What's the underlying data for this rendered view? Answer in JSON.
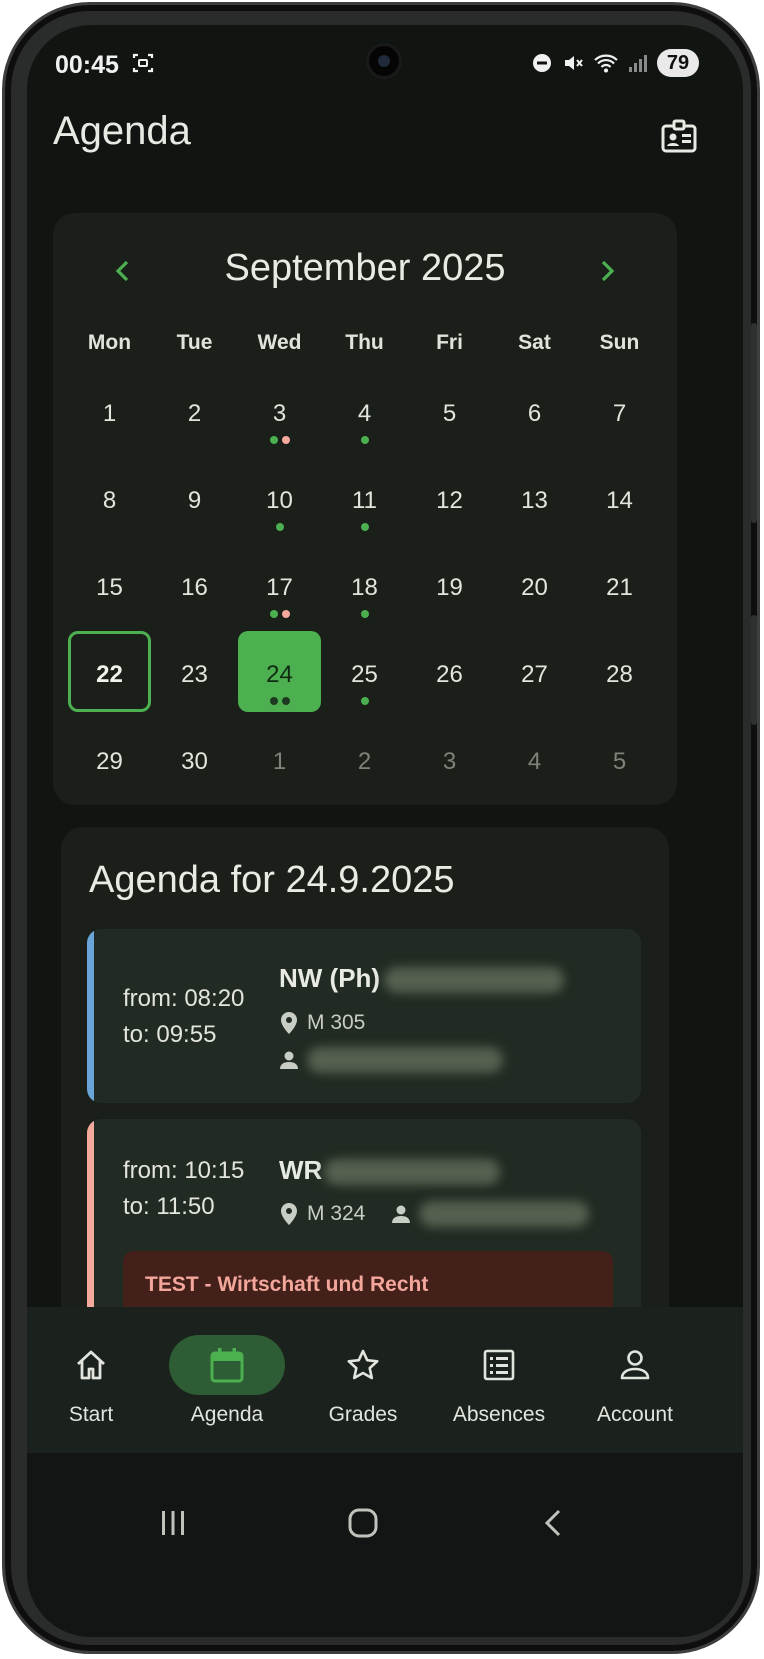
{
  "status_bar": {
    "time": "00:45",
    "battery": "79"
  },
  "header": {
    "title": "Agenda",
    "id_icon": "id-card-icon"
  },
  "calendar": {
    "month_label": "September 2025",
    "weekdays": [
      "Mon",
      "Tue",
      "Wed",
      "Thu",
      "Fri",
      "Sat",
      "Sun"
    ],
    "days": [
      {
        "label": "1"
      },
      {
        "label": "2"
      },
      {
        "label": "3",
        "dots": [
          "#4caf50",
          "#f4a99d"
        ]
      },
      {
        "label": "4",
        "dots": [
          "#4caf50"
        ]
      },
      {
        "label": "5"
      },
      {
        "label": "6"
      },
      {
        "label": "7"
      },
      {
        "label": "8"
      },
      {
        "label": "9"
      },
      {
        "label": "10",
        "dots": [
          "#4caf50"
        ]
      },
      {
        "label": "11",
        "dots": [
          "#4caf50"
        ]
      },
      {
        "label": "12"
      },
      {
        "label": "13"
      },
      {
        "label": "14"
      },
      {
        "label": "15"
      },
      {
        "label": "16"
      },
      {
        "label": "17",
        "dots": [
          "#4caf50",
          "#f4a99d"
        ]
      },
      {
        "label": "18",
        "dots": [
          "#4caf50"
        ]
      },
      {
        "label": "19"
      },
      {
        "label": "20"
      },
      {
        "label": "21"
      },
      {
        "label": "22",
        "today": true
      },
      {
        "label": "23"
      },
      {
        "label": "24",
        "selected": true,
        "dots": [
          "#1d3a20",
          "#1d3a20"
        ]
      },
      {
        "label": "25",
        "dots": [
          "#4caf50"
        ]
      },
      {
        "label": "26"
      },
      {
        "label": "27"
      },
      {
        "label": "28"
      },
      {
        "label": "29"
      },
      {
        "label": "30"
      },
      {
        "label": "1",
        "other": true
      },
      {
        "label": "2",
        "other": true
      },
      {
        "label": "3",
        "other": true
      },
      {
        "label": "4",
        "other": true
      },
      {
        "label": "5",
        "other": true
      }
    ]
  },
  "agenda": {
    "title": "Agenda for 24.9.2025",
    "lessons": [
      {
        "from": "from: 08:20",
        "to": "to: 09:55",
        "subject": "NW (Ph)",
        "room": "M 305",
        "accent": "#6aa5d9"
      },
      {
        "from": "from: 10:15",
        "to": "to: 11:50",
        "subject": "WR",
        "room": "M 324",
        "accent": "#f4a99d",
        "exam": "TEST - Wirtschaft und Recht"
      }
    ]
  },
  "bottom_nav": {
    "items": [
      {
        "label": "Start",
        "icon": "home-icon"
      },
      {
        "label": "Agenda",
        "icon": "calendar-icon",
        "active": true
      },
      {
        "label": "Grades",
        "icon": "star-icon"
      },
      {
        "label": "Absences",
        "icon": "list-icon"
      },
      {
        "label": "Account",
        "icon": "person-icon"
      }
    ]
  },
  "colors": {
    "accent": "#4caf50",
    "background": "#111511",
    "surface": "#1a1f1a",
    "exam_text": "#f3a69b"
  }
}
